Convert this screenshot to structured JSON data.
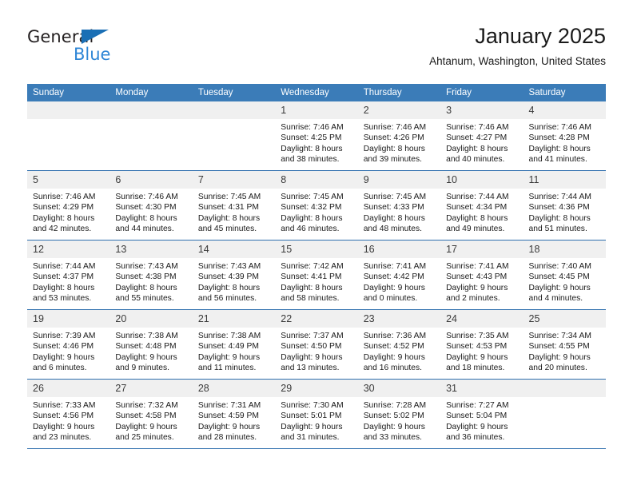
{
  "logo": {
    "word_one": "General",
    "word_two": "Blue",
    "accent_color": "#1a6fb5",
    "blue_text_color": "#2e86d6"
  },
  "header": {
    "title": "January 2025",
    "subtitle": "Ahtanum, Washington, United States",
    "header_bg_color": "#3b7cb8",
    "row_border_color": "#2f6fae",
    "daynum_bg_color": "#f0f0f0"
  },
  "weekdays": [
    "Sunday",
    "Monday",
    "Tuesday",
    "Wednesday",
    "Thursday",
    "Friday",
    "Saturday"
  ],
  "labels": {
    "sunrise_prefix": "Sunrise:",
    "sunset_prefix": "Sunset:",
    "daylight_prefix": "Daylight:"
  },
  "weeks": [
    [
      {
        "day": "",
        "empty": true
      },
      {
        "day": "",
        "empty": true
      },
      {
        "day": "",
        "empty": true
      },
      {
        "day": "1",
        "sunrise": "Sunrise: 7:46 AM",
        "sunset": "Sunset: 4:25 PM",
        "daylight1": "Daylight: 8 hours",
        "daylight2": "and 38 minutes."
      },
      {
        "day": "2",
        "sunrise": "Sunrise: 7:46 AM",
        "sunset": "Sunset: 4:26 PM",
        "daylight1": "Daylight: 8 hours",
        "daylight2": "and 39 minutes."
      },
      {
        "day": "3",
        "sunrise": "Sunrise: 7:46 AM",
        "sunset": "Sunset: 4:27 PM",
        "daylight1": "Daylight: 8 hours",
        "daylight2": "and 40 minutes."
      },
      {
        "day": "4",
        "sunrise": "Sunrise: 7:46 AM",
        "sunset": "Sunset: 4:28 PM",
        "daylight1": "Daylight: 8 hours",
        "daylight2": "and 41 minutes."
      }
    ],
    [
      {
        "day": "5",
        "sunrise": "Sunrise: 7:46 AM",
        "sunset": "Sunset: 4:29 PM",
        "daylight1": "Daylight: 8 hours",
        "daylight2": "and 42 minutes."
      },
      {
        "day": "6",
        "sunrise": "Sunrise: 7:46 AM",
        "sunset": "Sunset: 4:30 PM",
        "daylight1": "Daylight: 8 hours",
        "daylight2": "and 44 minutes."
      },
      {
        "day": "7",
        "sunrise": "Sunrise: 7:45 AM",
        "sunset": "Sunset: 4:31 PM",
        "daylight1": "Daylight: 8 hours",
        "daylight2": "and 45 minutes."
      },
      {
        "day": "8",
        "sunrise": "Sunrise: 7:45 AM",
        "sunset": "Sunset: 4:32 PM",
        "daylight1": "Daylight: 8 hours",
        "daylight2": "and 46 minutes."
      },
      {
        "day": "9",
        "sunrise": "Sunrise: 7:45 AM",
        "sunset": "Sunset: 4:33 PM",
        "daylight1": "Daylight: 8 hours",
        "daylight2": "and 48 minutes."
      },
      {
        "day": "10",
        "sunrise": "Sunrise: 7:44 AM",
        "sunset": "Sunset: 4:34 PM",
        "daylight1": "Daylight: 8 hours",
        "daylight2": "and 49 minutes."
      },
      {
        "day": "11",
        "sunrise": "Sunrise: 7:44 AM",
        "sunset": "Sunset: 4:36 PM",
        "daylight1": "Daylight: 8 hours",
        "daylight2": "and 51 minutes."
      }
    ],
    [
      {
        "day": "12",
        "sunrise": "Sunrise: 7:44 AM",
        "sunset": "Sunset: 4:37 PM",
        "daylight1": "Daylight: 8 hours",
        "daylight2": "and 53 minutes."
      },
      {
        "day": "13",
        "sunrise": "Sunrise: 7:43 AM",
        "sunset": "Sunset: 4:38 PM",
        "daylight1": "Daylight: 8 hours",
        "daylight2": "and 55 minutes."
      },
      {
        "day": "14",
        "sunrise": "Sunrise: 7:43 AM",
        "sunset": "Sunset: 4:39 PM",
        "daylight1": "Daylight: 8 hours",
        "daylight2": "and 56 minutes."
      },
      {
        "day": "15",
        "sunrise": "Sunrise: 7:42 AM",
        "sunset": "Sunset: 4:41 PM",
        "daylight1": "Daylight: 8 hours",
        "daylight2": "and 58 minutes."
      },
      {
        "day": "16",
        "sunrise": "Sunrise: 7:41 AM",
        "sunset": "Sunset: 4:42 PM",
        "daylight1": "Daylight: 9 hours",
        "daylight2": "and 0 minutes."
      },
      {
        "day": "17",
        "sunrise": "Sunrise: 7:41 AM",
        "sunset": "Sunset: 4:43 PM",
        "daylight1": "Daylight: 9 hours",
        "daylight2": "and 2 minutes."
      },
      {
        "day": "18",
        "sunrise": "Sunrise: 7:40 AM",
        "sunset": "Sunset: 4:45 PM",
        "daylight1": "Daylight: 9 hours",
        "daylight2": "and 4 minutes."
      }
    ],
    [
      {
        "day": "19",
        "sunrise": "Sunrise: 7:39 AM",
        "sunset": "Sunset: 4:46 PM",
        "daylight1": "Daylight: 9 hours",
        "daylight2": "and 6 minutes."
      },
      {
        "day": "20",
        "sunrise": "Sunrise: 7:38 AM",
        "sunset": "Sunset: 4:48 PM",
        "daylight1": "Daylight: 9 hours",
        "daylight2": "and 9 minutes."
      },
      {
        "day": "21",
        "sunrise": "Sunrise: 7:38 AM",
        "sunset": "Sunset: 4:49 PM",
        "daylight1": "Daylight: 9 hours",
        "daylight2": "and 11 minutes."
      },
      {
        "day": "22",
        "sunrise": "Sunrise: 7:37 AM",
        "sunset": "Sunset: 4:50 PM",
        "daylight1": "Daylight: 9 hours",
        "daylight2": "and 13 minutes."
      },
      {
        "day": "23",
        "sunrise": "Sunrise: 7:36 AM",
        "sunset": "Sunset: 4:52 PM",
        "daylight1": "Daylight: 9 hours",
        "daylight2": "and 16 minutes."
      },
      {
        "day": "24",
        "sunrise": "Sunrise: 7:35 AM",
        "sunset": "Sunset: 4:53 PM",
        "daylight1": "Daylight: 9 hours",
        "daylight2": "and 18 minutes."
      },
      {
        "day": "25",
        "sunrise": "Sunrise: 7:34 AM",
        "sunset": "Sunset: 4:55 PM",
        "daylight1": "Daylight: 9 hours",
        "daylight2": "and 20 minutes."
      }
    ],
    [
      {
        "day": "26",
        "sunrise": "Sunrise: 7:33 AM",
        "sunset": "Sunset: 4:56 PM",
        "daylight1": "Daylight: 9 hours",
        "daylight2": "and 23 minutes."
      },
      {
        "day": "27",
        "sunrise": "Sunrise: 7:32 AM",
        "sunset": "Sunset: 4:58 PM",
        "daylight1": "Daylight: 9 hours",
        "daylight2": "and 25 minutes."
      },
      {
        "day": "28",
        "sunrise": "Sunrise: 7:31 AM",
        "sunset": "Sunset: 4:59 PM",
        "daylight1": "Daylight: 9 hours",
        "daylight2": "and 28 minutes."
      },
      {
        "day": "29",
        "sunrise": "Sunrise: 7:30 AM",
        "sunset": "Sunset: 5:01 PM",
        "daylight1": "Daylight: 9 hours",
        "daylight2": "and 31 minutes."
      },
      {
        "day": "30",
        "sunrise": "Sunrise: 7:28 AM",
        "sunset": "Sunset: 5:02 PM",
        "daylight1": "Daylight: 9 hours",
        "daylight2": "and 33 minutes."
      },
      {
        "day": "31",
        "sunrise": "Sunrise: 7:27 AM",
        "sunset": "Sunset: 5:04 PM",
        "daylight1": "Daylight: 9 hours",
        "daylight2": "and 36 minutes."
      },
      {
        "day": "",
        "empty": true
      }
    ]
  ]
}
